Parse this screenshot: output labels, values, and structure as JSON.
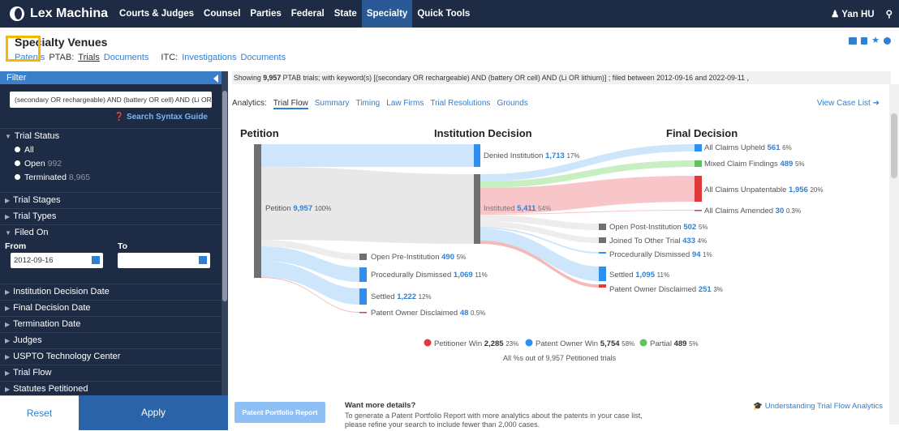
{
  "app": {
    "name": "Lex Machina"
  },
  "nav": {
    "items": [
      "Courts & Judges",
      "Counsel",
      "Parties",
      "Federal",
      "State",
      "Specialty",
      "Quick Tools"
    ],
    "active": "Specialty",
    "user": "Yan HU"
  },
  "header": {
    "title": "Specialty Venues",
    "patents": "Patents",
    "ptab_label": "PTAB:",
    "trials": "Trials",
    "documents": "Documents",
    "itc_label": "ITC:",
    "investigations": "Investigations",
    "itc_documents": "Documents"
  },
  "sidebar": {
    "filter_title": "Filter",
    "search_value": "(secondary OR rechargeable) AND (battery OR cell) AND (Li OR",
    "syntax_guide": "Search Syntax Guide",
    "trial_status": {
      "title": "Trial Status",
      "all": "All",
      "open_label": "Open",
      "open_count": "992",
      "terminated_label": "Terminated",
      "terminated_count": "8,965"
    },
    "trial_stages": "Trial Stages",
    "trial_types": "Trial Types",
    "filed_on": {
      "title": "Filed On",
      "from_label": "From",
      "to_label": "To",
      "from_value": "2012-09-16",
      "to_value": ""
    },
    "sections": [
      "Institution Decision Date",
      "Final Decision Date",
      "Termination Date",
      "Judges",
      "USPTO Technology Center",
      "Trial Flow",
      "Statutes Petitioned"
    ],
    "reset": "Reset",
    "apply": "Apply"
  },
  "showing": {
    "prefix": "Showing",
    "count": "9,957",
    "suffix": "PTAB trials;",
    "keyword": "with keyword(s) [(secondary OR rechargeable) AND (battery OR cell) AND (Li OR lithium)]",
    "sep": ";",
    "filed": "filed between 2012-09-16 and 2022-09-11",
    "end": ","
  },
  "tabs": {
    "prefix": "Analytics:",
    "items": [
      "Trial Flow",
      "Summary",
      "Timing",
      "Law Firms",
      "Trial Resolutions",
      "Grounds"
    ],
    "active": "Trial Flow",
    "view_case_list": "View Case List"
  },
  "flow": {
    "col_petition": "Petition",
    "col_institution": "Institution Decision",
    "col_final": "Final Decision",
    "petition": {
      "label": "Petition",
      "count": "9,957",
      "pct": "100%"
    },
    "denied": {
      "label": "Denied Institution",
      "count": "1,713",
      "pct": "17%"
    },
    "instituted": {
      "label": "Instituted",
      "count": "5,411",
      "pct": "54%"
    },
    "open_pre": {
      "label": "Open Pre-Institution",
      "count": "490",
      "pct": "5%"
    },
    "proc_dismissed_pre": {
      "label": "Procedurally Dismissed",
      "count": "1,069",
      "pct": "11%"
    },
    "settled_pre": {
      "label": "Settled",
      "count": "1,222",
      "pct": "12%"
    },
    "po_disclaimed_pre": {
      "label": "Patent Owner Disclaimed",
      "count": "48",
      "pct": "0.5%"
    },
    "upheld": {
      "label": "All Claims Upheld",
      "count": "561",
      "pct": "6%"
    },
    "mixed": {
      "label": "Mixed Claim Findings",
      "count": "489",
      "pct": "5%"
    },
    "unpatentable": {
      "label": "All Claims Unpatentable",
      "count": "1,956",
      "pct": "20%"
    },
    "amended": {
      "label": "All Claims Amended",
      "count": "30",
      "pct": "0.3%"
    },
    "open_post": {
      "label": "Open Post-Institution",
      "count": "502",
      "pct": "5%"
    },
    "joined": {
      "label": "Joined To Other Trial",
      "count": "433",
      "pct": "4%"
    },
    "proc_dismissed_post": {
      "label": "Procedurally Dismissed",
      "count": "94",
      "pct": "1%"
    },
    "settled_post": {
      "label": "Settled",
      "count": "1,095",
      "pct": "11%"
    },
    "po_disclaimed_post": {
      "label": "Patent Owner Disclaimed",
      "count": "251",
      "pct": "3%"
    }
  },
  "legend": {
    "petitioner": {
      "label": "Petitioner Win",
      "count": "2,285",
      "pct": "23%"
    },
    "owner": {
      "label": "Patent Owner Win",
      "count": "5,754",
      "pct": "58%"
    },
    "partial": {
      "label": "Partial",
      "count": "489",
      "pct": "5%"
    },
    "note": "All %s out of 9,957 Petitioned trials"
  },
  "footer": {
    "report_button": "Patent Portfolio Report",
    "want_title": "Want more details?",
    "want_line1": "To generate a Patent Portfolio Report with more analytics about the patents in your case list,",
    "want_line2": "please refine your search to include fewer than 2,000 cases.",
    "understanding": "Understanding Trial Flow Analytics"
  },
  "colors": {
    "nav": "#1d2c44",
    "accent": "#2f7fd3",
    "red": "#e03a3a",
    "green": "#5fc35f",
    "grey": "#7b7b7b"
  }
}
